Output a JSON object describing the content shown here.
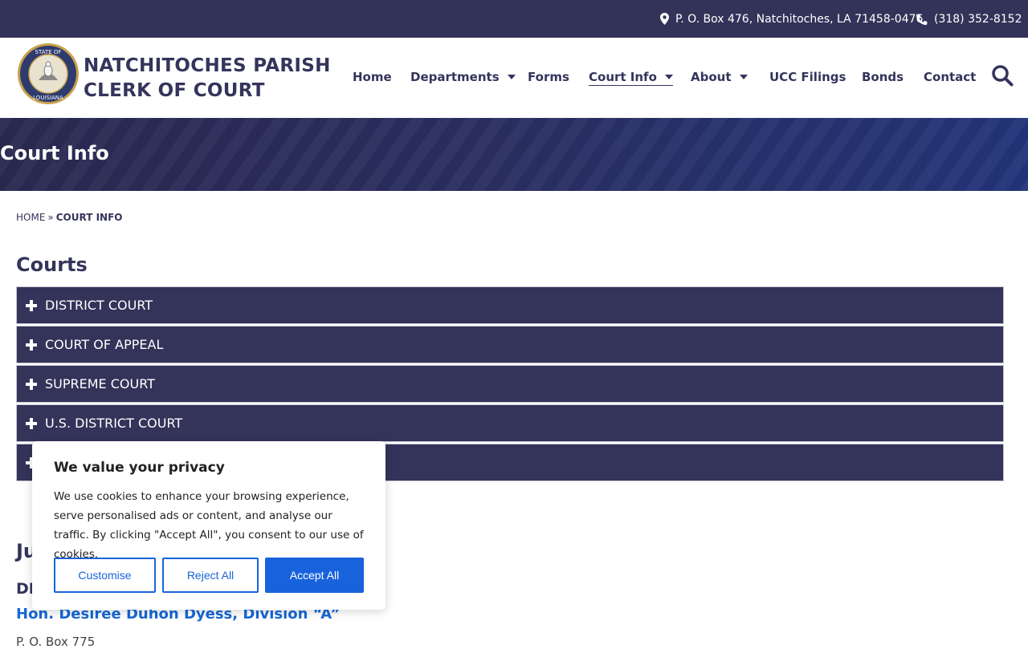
{
  "topbar": {
    "address": "P. O. Box 476, Natchitoches, LA 71458-0476",
    "phone": "(318) 352-8152",
    "icons": [
      "map-marker-icon",
      "phone-icon"
    ]
  },
  "header": {
    "title_line1": "NATCHITOCHES PARISH",
    "title_line2": "CLERK OF COURT",
    "seal_text_top": "STATE OF",
    "seal_text_bottom": "LOUISIANA",
    "nav": [
      {
        "label": "Home",
        "dropdown": false,
        "active": false
      },
      {
        "label": "Departments",
        "dropdown": true,
        "active": false
      },
      {
        "label": "Forms",
        "dropdown": false,
        "active": false
      },
      {
        "label": "Court Info",
        "dropdown": true,
        "active": true
      },
      {
        "label": "About",
        "dropdown": true,
        "active": false
      },
      {
        "label": "UCC Filings",
        "dropdown": false,
        "active": false
      },
      {
        "label": "Bonds",
        "dropdown": false,
        "active": false
      },
      {
        "label": "Contact",
        "dropdown": false,
        "active": false
      }
    ]
  },
  "banner": {
    "title": "Court Info"
  },
  "breadcrumb": {
    "home": "HOME",
    "separator": "»",
    "current": "COURT INFO"
  },
  "courts": {
    "title": "Courts",
    "items": [
      "DISTRICT COURT",
      "COURT OF APPEAL",
      "SUPREME COURT",
      "U.S. DISTRICT COURT",
      ""
    ]
  },
  "judges": {
    "title": "Ju",
    "district_title": "DI",
    "judge_name": "Hon. Desiree Duhon Dyess, Division “A”",
    "judge_line": "P. O. Box 775"
  },
  "cookie": {
    "title": "We value your privacy",
    "body": "We use cookies to enhance your browsing experience, serve personalised ads or content, and analyse our traffic. By clicking \"Accept All\", you consent to our use of cookies.",
    "customise": "Customise",
    "reject": "Reject All",
    "accept": "Accept All"
  },
  "colors": {
    "primary": "#34345c",
    "link": "#1668d6",
    "cookie_button": "#1863dc"
  }
}
